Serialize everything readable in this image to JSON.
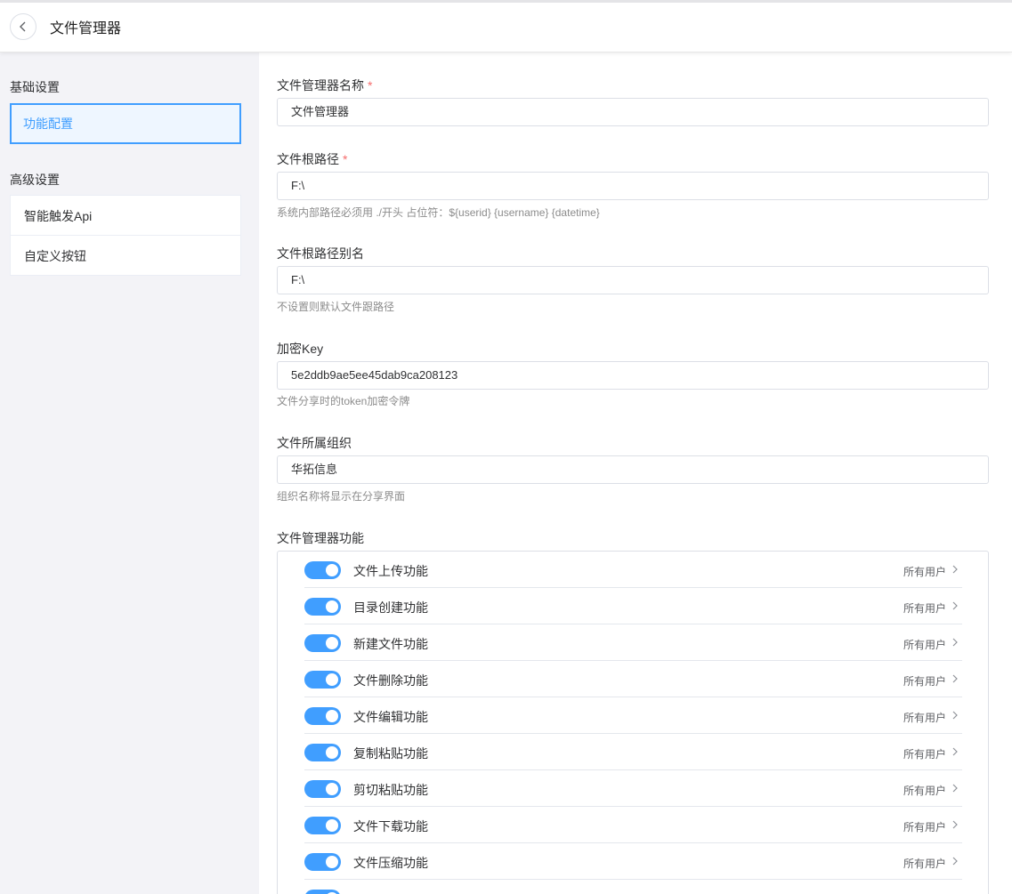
{
  "header": {
    "title": "文件管理器"
  },
  "sidebar": {
    "basic_title": "基础设置",
    "basic_items": [
      "功能配置"
    ],
    "advanced_title": "高级设置",
    "advanced_items": [
      "智能触发Api",
      "自定义按钮"
    ]
  },
  "form": {
    "name": {
      "label": "文件管理器名称",
      "value": "文件管理器",
      "required": "*"
    },
    "root": {
      "label": "文件根路径",
      "value": "F:\\",
      "required": "*",
      "hint": "系统内部路径必须用 ./开头 占位符：${userid} {username} {datetime}"
    },
    "alias": {
      "label": "文件根路径别名",
      "value": "F:\\",
      "hint": "不设置则默认文件跟路径"
    },
    "key": {
      "label": "加密Key",
      "value": "5e2ddb9ae5ee45dab9ca208123",
      "hint": "文件分享时的token加密令牌"
    },
    "org": {
      "label": "文件所属组织",
      "value": "华拓信息",
      "hint": "组织名称将显示在分享界面"
    }
  },
  "functions": {
    "title": "文件管理器功能",
    "items": [
      {
        "name": "文件上传功能",
        "scope": "所有用户",
        "enabled": true
      },
      {
        "name": "目录创建功能",
        "scope": "所有用户",
        "enabled": true
      },
      {
        "name": "新建文件功能",
        "scope": "所有用户",
        "enabled": true
      },
      {
        "name": "文件删除功能",
        "scope": "所有用户",
        "enabled": true
      },
      {
        "name": "文件编辑功能",
        "scope": "所有用户",
        "enabled": true
      },
      {
        "name": "复制粘贴功能",
        "scope": "所有用户",
        "enabled": true
      },
      {
        "name": "剪切粘贴功能",
        "scope": "所有用户",
        "enabled": true
      },
      {
        "name": "文件下载功能",
        "scope": "所有用户",
        "enabled": true
      },
      {
        "name": "文件压缩功能",
        "scope": "所有用户",
        "enabled": true
      },
      {
        "name": "",
        "scope": "",
        "enabled": true
      }
    ]
  },
  "colors": {
    "accent": "#409eff",
    "required": "#f56c6c",
    "sidebar_bg": "#f3f3f7"
  }
}
